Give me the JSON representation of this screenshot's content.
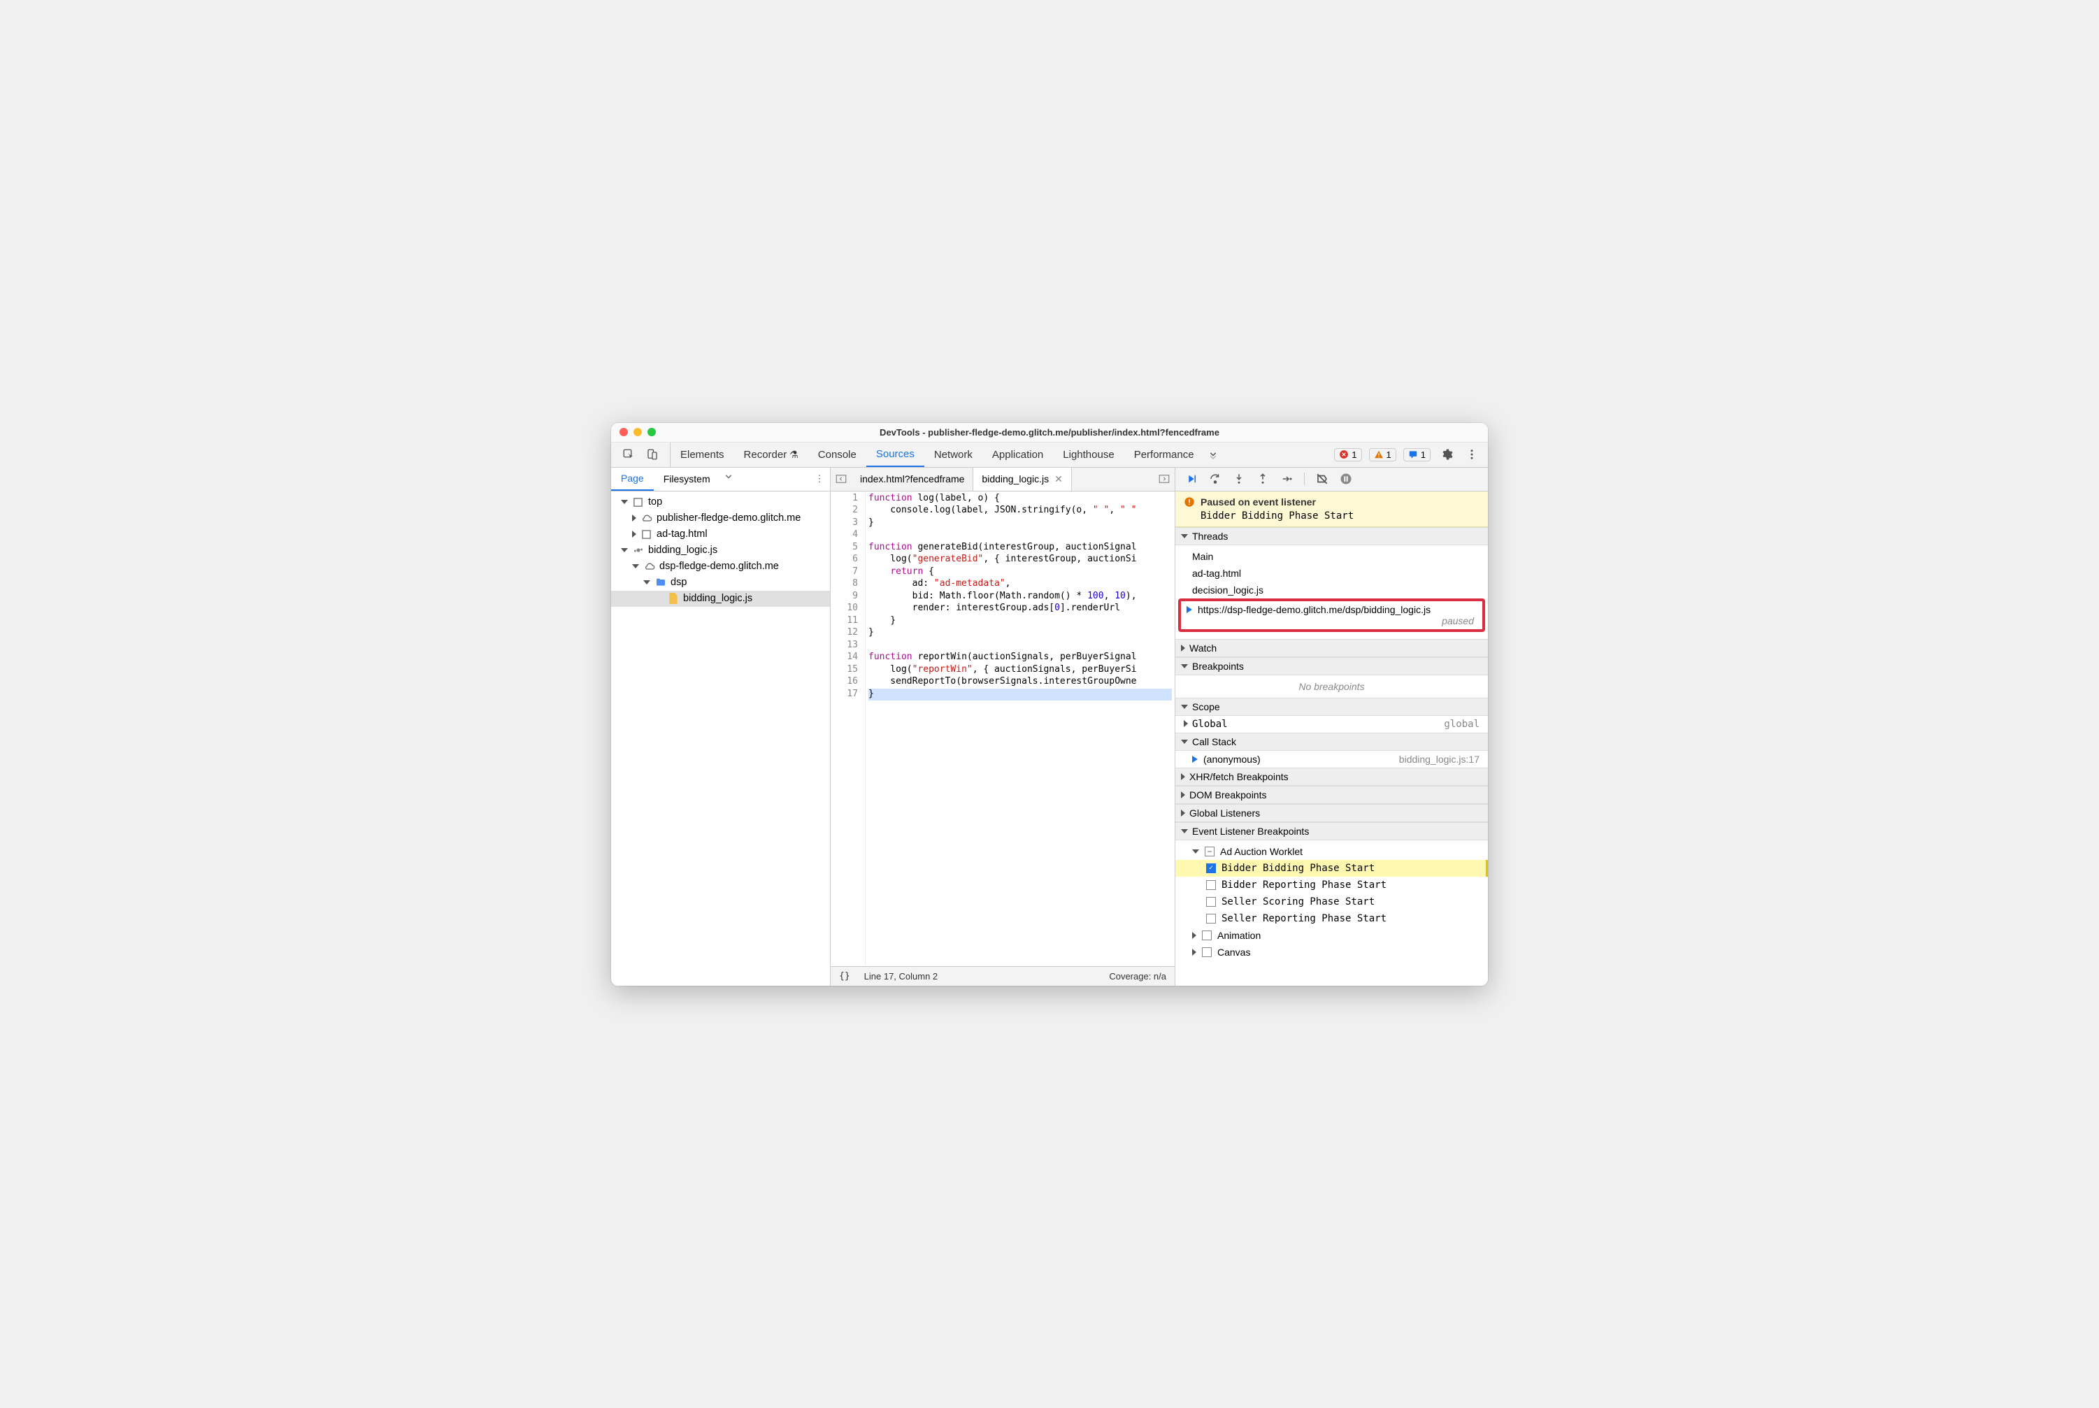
{
  "titlebar": "DevTools - publisher-fledge-demo.glitch.me/publisher/index.html?fencedframe",
  "topTabs": [
    "Elements",
    "Recorder",
    "Console",
    "Sources",
    "Network",
    "Application",
    "Lighthouse",
    "Performance"
  ],
  "activeTopTab": "Sources",
  "errorCount": "1",
  "warnCount": "1",
  "msgCount": "1",
  "sidebarTabs": {
    "page": "Page",
    "filesystem": "Filesystem"
  },
  "tree": {
    "top": "top",
    "publisher": "publisher-fledge-demo.glitch.me",
    "adtag": "ad-tag.html",
    "biddingRoot": "bidding_logic.js",
    "dspHost": "dsp-fledge-demo.glitch.me",
    "dspFolder": "dsp",
    "biddingFile": "bidding_logic.js"
  },
  "editorTabs": {
    "tab1": "index.html?fencedframe",
    "tab2": "bidding_logic.js"
  },
  "codeLines": [
    {
      "n": "1",
      "html": "<span class='kw'>function</span> log(label, o) {"
    },
    {
      "n": "2",
      "html": "    console.log(label, JSON.stringify(o, <span class='str'>\" \"</span>, <span class='str'>\" \"</span>"
    },
    {
      "n": "3",
      "html": "}"
    },
    {
      "n": "4",
      "html": ""
    },
    {
      "n": "5",
      "html": "<span class='kw'>function</span> generateBid(interestGroup, auctionSignal"
    },
    {
      "n": "6",
      "html": "    log(<span class='str'>\"generateBid\"</span>, { interestGroup, auctionSi"
    },
    {
      "n": "7",
      "html": "    <span class='kw'>return</span> {"
    },
    {
      "n": "8",
      "html": "        ad: <span class='str'>\"ad-metadata\"</span>,"
    },
    {
      "n": "9",
      "html": "        bid: Math.floor(Math.random() * <span class='num'>100</span>, <span class='num'>10</span>),"
    },
    {
      "n": "10",
      "html": "        render: interestGroup.ads[<span class='num'>0</span>].renderUrl"
    },
    {
      "n": "11",
      "html": "    }"
    },
    {
      "n": "12",
      "html": "}"
    },
    {
      "n": "13",
      "html": ""
    },
    {
      "n": "14",
      "html": "<span class='kw'>function</span> reportWin(auctionSignals, perBuyerSignal"
    },
    {
      "n": "15",
      "html": "    log(<span class='str'>\"reportWin\"</span>, { auctionSignals, perBuyerSi"
    },
    {
      "n": "16",
      "html": "    sendReportTo(browserSignals.interestGroupOwne"
    },
    {
      "n": "17",
      "html": "}",
      "hl": true
    }
  ],
  "statusbar": {
    "pos": "Line 17, Column 2",
    "coverage": "Coverage: n/a"
  },
  "pauseBanner": {
    "title": "Paused on event listener",
    "sub": "Bidder Bidding Phase Start"
  },
  "sections": {
    "threads": "Threads",
    "watch": "Watch",
    "breakpoints": "Breakpoints",
    "scope": "Scope",
    "callstack": "Call Stack",
    "xhr": "XHR/fetch Breakpoints",
    "dom": "DOM Breakpoints",
    "gl": "Global Listeners",
    "elb": "Event Listener Breakpoints"
  },
  "threads": {
    "main": "Main",
    "adtag": "ad-tag.html",
    "decision": "decision_logic.js",
    "active": "https://dsp-fledge-demo.glitch.me/dsp/bidding_logic.js",
    "paused": "paused"
  },
  "noBreakpoints": "No breakpoints",
  "scope": {
    "global": "Global",
    "globalVal": "global"
  },
  "callstack": {
    "frame": "(anonymous)",
    "loc": "bidding_logic.js:17"
  },
  "elb": {
    "adAuction": "Ad Auction Worklet",
    "items": [
      "Bidder Bidding Phase Start",
      "Bidder Reporting Phase Start",
      "Seller Scoring Phase Start",
      "Seller Reporting Phase Start"
    ],
    "animation": "Animation",
    "canvas": "Canvas"
  }
}
